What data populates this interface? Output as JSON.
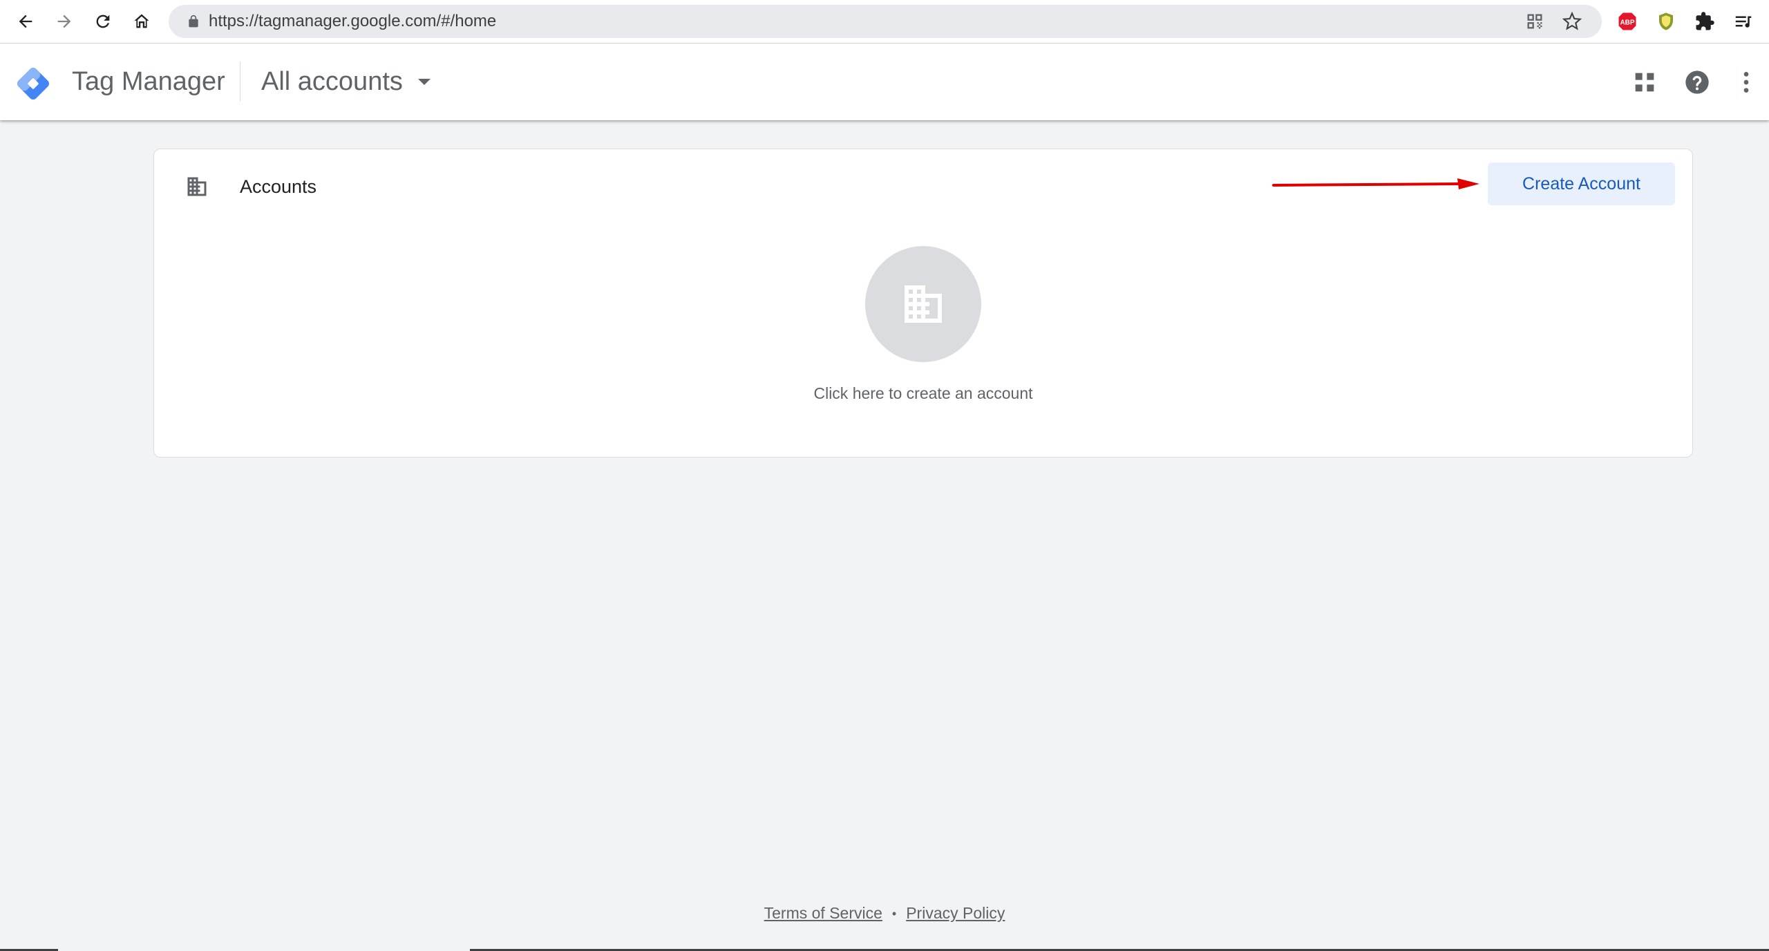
{
  "browser": {
    "url": "https://tagmanager.google.com/#/home",
    "toolbar_icons": [
      "back-icon",
      "forward-icon",
      "reload-icon",
      "home-icon"
    ],
    "omnibox_icons": [
      "qr-code-icon",
      "star-icon"
    ],
    "extensions": [
      "adblock-plus-icon",
      "shield-extension-icon",
      "puzzle-extensions-icon",
      "reading-list-icon"
    ]
  },
  "appbar": {
    "product_name": "Tag Manager",
    "account_selector": "All accounts",
    "icons": [
      "apps-grid-icon",
      "help-icon",
      "more-vert-icon"
    ]
  },
  "card": {
    "title": "Accounts",
    "create_button": "Create Account",
    "empty_state_text": "Click here to create an account",
    "annotation_color": "#e00000"
  },
  "footer": {
    "terms": "Terms of Service",
    "separator": "•",
    "privacy": "Privacy Policy"
  },
  "colors": {
    "accent": "#1a73e8",
    "button_bg": "#e8f0fe",
    "page_bg": "#f1f3f4"
  }
}
